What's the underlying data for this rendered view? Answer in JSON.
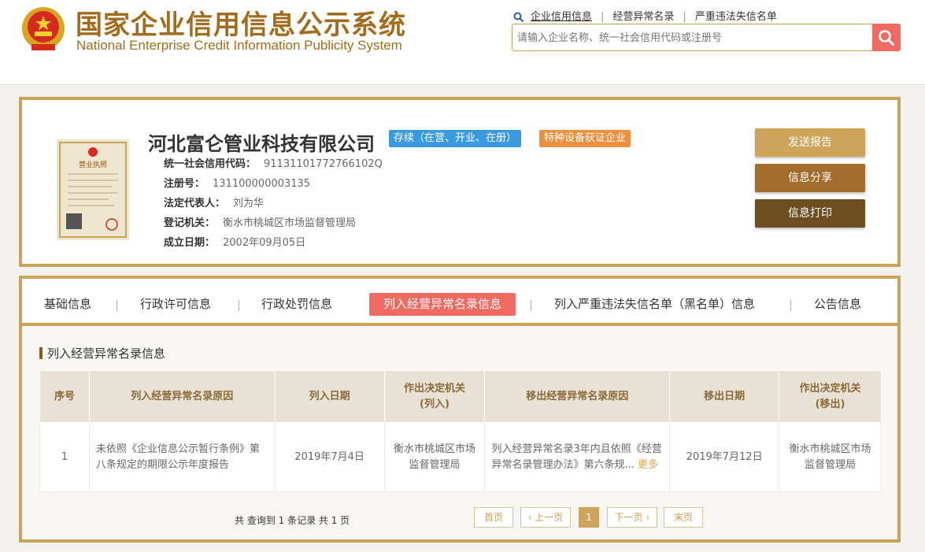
{
  "header": {
    "title_cn": "国家企业信用信息公示系统",
    "title_en": "National Enterprise Credit Information Publicity System",
    "top_links": [
      "企业信用信息",
      "经营异常名录",
      "严重违法失信名单"
    ],
    "search_placeholder": "请输入企业名称、统一社会信用代码或注册号",
    "search_icon": "magnifier-icon"
  },
  "company": {
    "name": "河北富仑管业科技有限公司",
    "status_badge": "存续（在营、开业、在册）",
    "special_badge": "特种设备获证企业",
    "license_title": "营业执照",
    "fields": [
      {
        "label": "统一社会信用代码：",
        "value": "91131101772766102Q"
      },
      {
        "label": "注册号：",
        "value": "131100000003135"
      },
      {
        "label": "法定代表人：",
        "value": "刘为华"
      },
      {
        "label": "登记机关：",
        "value": "衡水市桃城区市场监督管理局"
      },
      {
        "label": "成立日期：",
        "value": "2002年09月05日"
      }
    ],
    "actions": {
      "send": "发送报告",
      "share": "信息分享",
      "print": "信息打印"
    }
  },
  "tabs": [
    "基础信息",
    "行政许可信息",
    "行政处罚信息",
    "列入经营异常名录信息",
    "列入严重违法失信名单（黑名单）信息",
    "公告信息"
  ],
  "active_tab": 3,
  "section": {
    "title": "列入经营异常名录信息",
    "headers": {
      "no": "序号",
      "reason_in": "列入经营异常名录原因",
      "date_in": "列入日期",
      "authority_in_1": "作出决定机关",
      "authority_in_2": "(列入)",
      "reason_out": "移出经营异常名录原因",
      "date_out": "移出日期",
      "authority_out_1": "作出决定机关",
      "authority_out_2": "(移出)"
    },
    "rows": [
      {
        "no": "1",
        "reason_in": "未依照《企业信息公示暂行条例》第八条规定的期限公示年度报告",
        "date_in": "2019年7月4日",
        "authority_in": "衡水市桃城区市场监督管理局",
        "reason_out": "列入经营异常名录3年内且依照《经营异常名录管理办法》第六条规...",
        "more": "更多",
        "date_out": "2019年7月12日",
        "authority_out": "衡水市桃城区市场监督管理局"
      }
    ]
  },
  "pager": {
    "summary": "共 查询到 1 条记录 共 1 页",
    "first": "首页",
    "prev": "上一页",
    "current": "1",
    "next": "下一页",
    "last": "末页"
  },
  "colors": {
    "gold": "#c9a55a",
    "accent_red": "#ef6b62",
    "brown": "#a26c1c"
  }
}
